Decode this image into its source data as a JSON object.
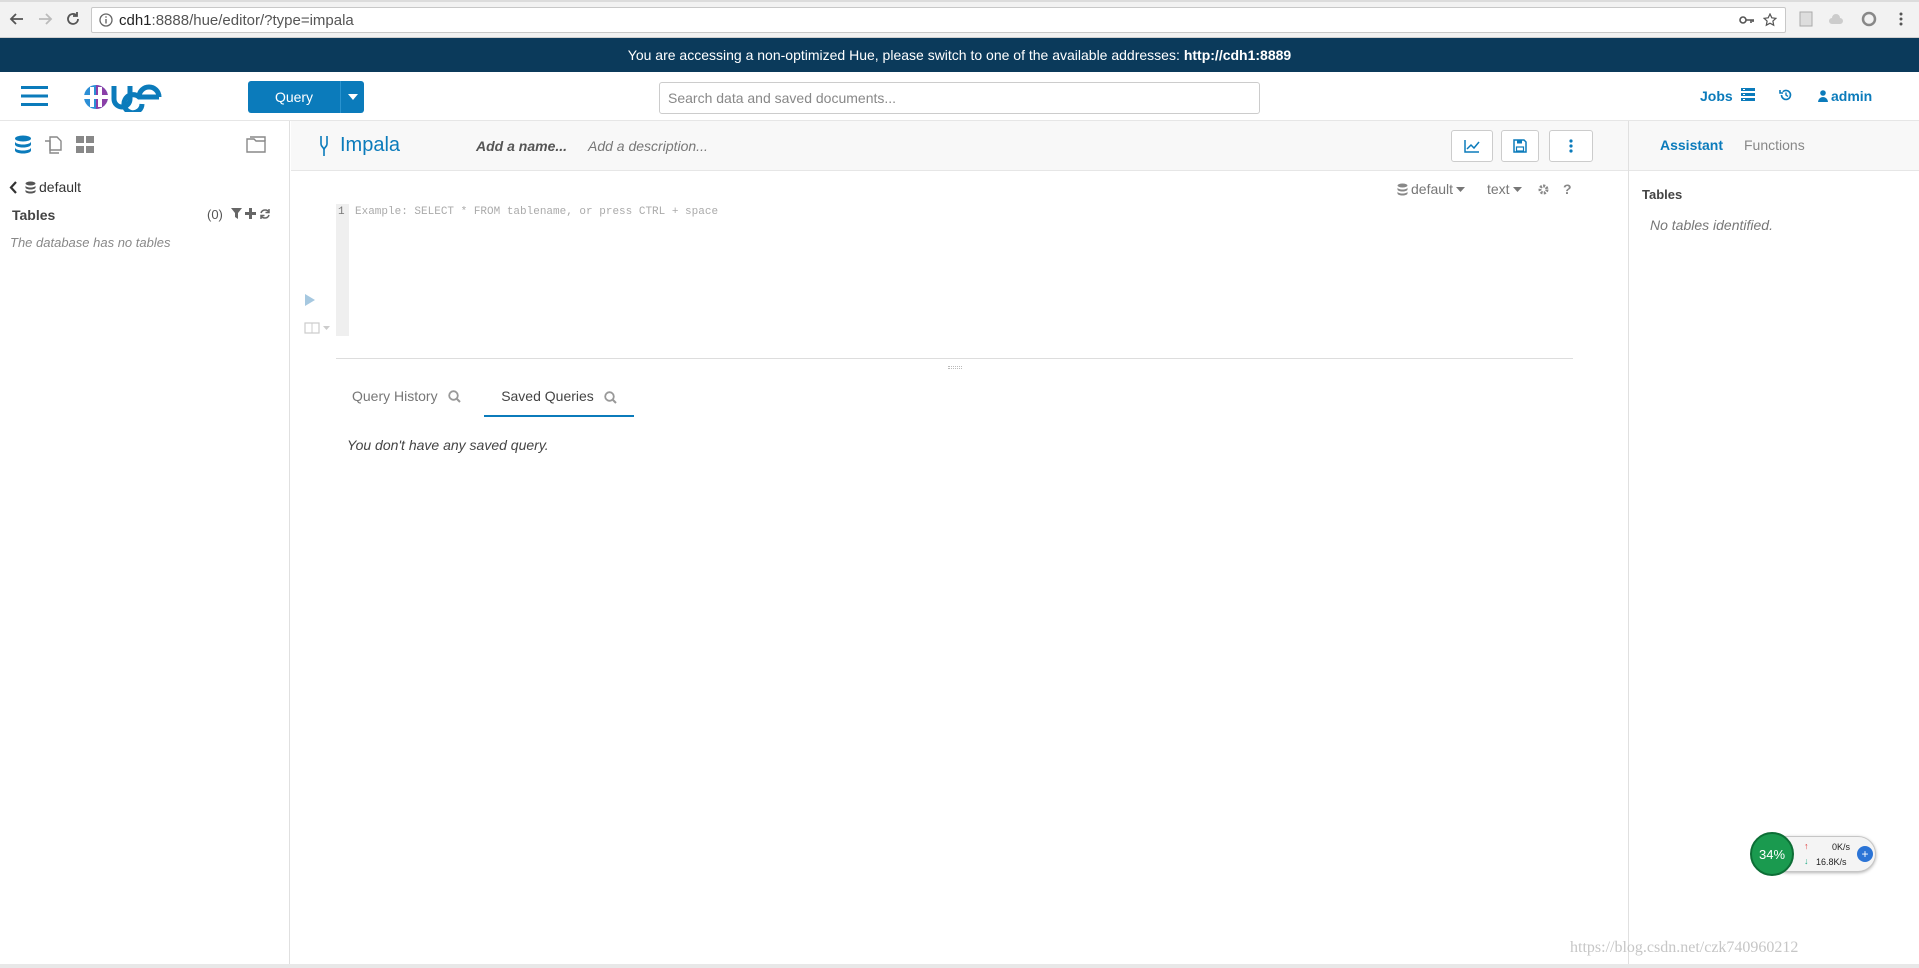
{
  "browser": {
    "url_host": "cdh1",
    "url_rest": ":8888/hue/editor/?type=impala"
  },
  "banner": {
    "text": "You are accessing a non-optimized Hue, please switch to one of the available addresses:",
    "link": "http://cdh1:8889"
  },
  "navbar": {
    "query_label": "Query",
    "search_placeholder": "Search data and saved documents...",
    "jobs_label": "Jobs",
    "user_label": "admin"
  },
  "left_panel": {
    "database": "default",
    "tables_label": "Tables",
    "tables_count": "(0)",
    "empty_text": "The database has no tables"
  },
  "editor": {
    "title": "Impala",
    "name_placeholder": "Add a name...",
    "description_placeholder": "Add a description...",
    "database": "default",
    "format": "text",
    "help": "?",
    "line_number": "1",
    "code_placeholder": "Example: SELECT * FROM tablename, or press CTRL + space"
  },
  "results": {
    "tabs": [
      {
        "label": "Query History"
      },
      {
        "label": "Saved Queries"
      }
    ],
    "empty_text": "You don't have any saved query."
  },
  "right_panel": {
    "tabs": [
      {
        "label": "Assistant"
      },
      {
        "label": "Functions"
      }
    ],
    "tables_label": "Tables",
    "empty_text": "No tables identified."
  },
  "speed_widget": {
    "percent": "34%",
    "up": "0K/s",
    "down": "16.8K/s"
  },
  "watermark": "https://blog.csdn.net/czk740960212",
  "colors": {
    "accent": "#0b7bbb",
    "banner": "#0b3a5b"
  }
}
